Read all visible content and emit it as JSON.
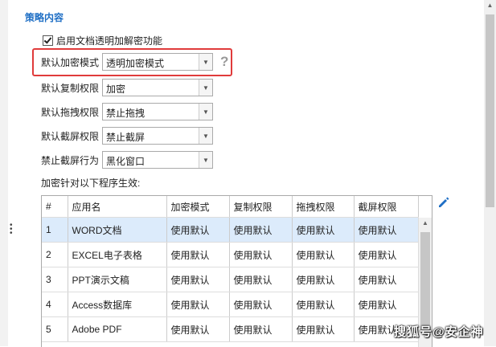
{
  "section_title": "策略内容",
  "enable_checkbox": {
    "label": "启用文档透明加解密功能",
    "checked": true
  },
  "settings": [
    {
      "label": "默认加密模式",
      "value": "透明加密模式"
    },
    {
      "label": "默认复制权限",
      "value": "加密"
    },
    {
      "label": "默认拖拽权限",
      "value": "禁止拖拽"
    },
    {
      "label": "默认截屏权限",
      "value": "禁止截屏"
    },
    {
      "label": "禁止截屏行为",
      "value": "黑化窗口"
    }
  ],
  "help_icon": "?",
  "program_list_label": "加密针对以下程序生效:",
  "table": {
    "headers": [
      "#",
      "应用名",
      "加密模式",
      "复制权限",
      "拖拽权限",
      "截屏权限"
    ],
    "rows": [
      [
        "1",
        "WORD文档",
        "使用默认",
        "使用默认",
        "使用默认",
        "使用默认"
      ],
      [
        "2",
        "EXCEL电子表格",
        "使用默认",
        "使用默认",
        "使用默认",
        "使用默认"
      ],
      [
        "3",
        "PPT演示文稿",
        "使用默认",
        "使用默认",
        "使用默认",
        "使用默认"
      ],
      [
        "4",
        "Access数据库",
        "使用默认",
        "使用默认",
        "使用默认",
        "使用默认"
      ],
      [
        "5",
        "Adobe PDF",
        "使用默认",
        "使用默认",
        "使用默认",
        "使用默认"
      ]
    ]
  },
  "watermark": "搜狐号@安企神",
  "colors": {
    "accent": "#1f6fc5",
    "highlight": "#e03b3b",
    "selected_row": "#dcebfb"
  },
  "icons": {
    "edit": "pencil-icon",
    "help": "question-icon"
  }
}
